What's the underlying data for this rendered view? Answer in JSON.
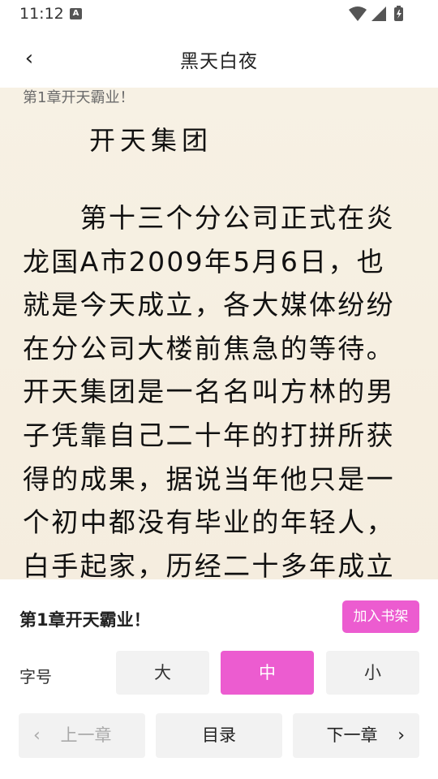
{
  "status": {
    "time": "11:12",
    "badge": "A"
  },
  "header": {
    "title": "黑天白夜",
    "back_icon": "‹"
  },
  "reader": {
    "chapter_label": "第1章开天霸业！",
    "heading": "开天集团",
    "lines": [
      "　　第十三个分公司正式在炎",
      "龙国A市2009年5月6日，也",
      "就是今天成立，各大媒体纷纷",
      "在分公司大楼前焦急的等待。",
      "开天集团是一名名叫方林的男",
      "子凭靠自己二十年的打拼所获",
      "得的成果，据说当年他只是一",
      "个初中都没有毕业的年轻人，",
      "白手起家，历经二十多年成立"
    ]
  },
  "panel": {
    "chapter_title": "第1章开天霸业！",
    "add_shelf_label": "加入书架",
    "font_size_label": "字号",
    "sizes": {
      "large": "大",
      "medium": "中",
      "small": "小"
    },
    "selected_size": "中",
    "nav": {
      "prev": "上一章",
      "toc": "目录",
      "next": "下一章",
      "prev_icon": "‹",
      "next_icon": "›"
    }
  },
  "colors": {
    "accent": "#ec5cd0",
    "paper": "#f6efe1",
    "button_bg": "#f2f2f2"
  }
}
